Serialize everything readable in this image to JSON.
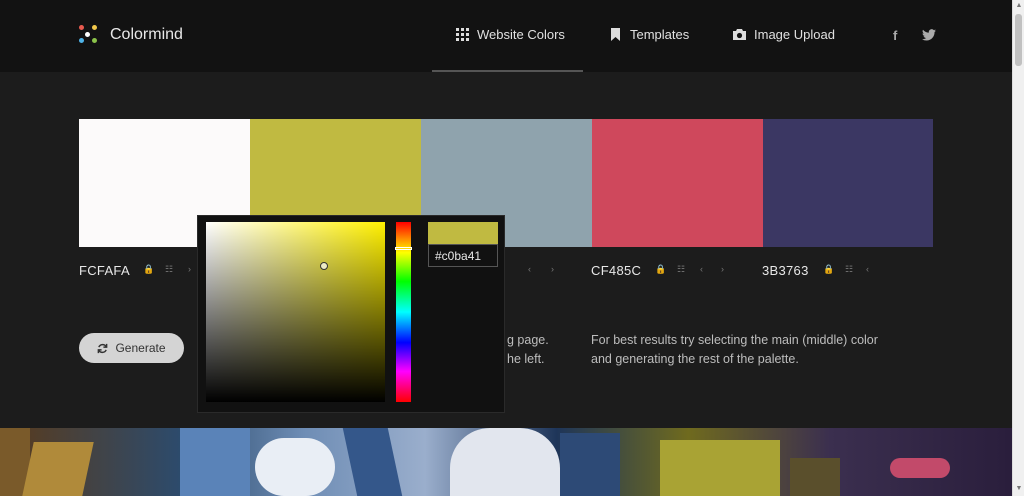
{
  "header": {
    "brand": "Colormind",
    "nav": [
      {
        "label": "Website Colors",
        "icon": "grid-icon"
      },
      {
        "label": "Templates",
        "icon": "bookmark-icon"
      },
      {
        "label": "Image Upload",
        "icon": "camera-icon"
      }
    ],
    "social": {
      "facebook": "f",
      "twitter": "twitter-icon"
    }
  },
  "palette": [
    {
      "hex": "FCFAFA",
      "color": "#fcfafa"
    },
    {
      "hex": "",
      "color": "#c0ba41"
    },
    {
      "hex": "",
      "color": "#8fa3ad"
    },
    {
      "hex": "CF485C",
      "color": "#cf485c"
    },
    {
      "hex": "3B3763",
      "color": "#3b3763"
    }
  ],
  "controls": {
    "lock": "🔒",
    "adjust": "☷",
    "left": "‹",
    "right": "›"
  },
  "generate_label": "Generate",
  "help": {
    "left_line1": "g page.",
    "left_line2": "he left.",
    "right_line1": "For best results try selecting the main (middle) color",
    "right_line2": "and generating the rest of the palette."
  },
  "picker": {
    "value": "#c0ba41",
    "preview_color": "#c0ba41"
  }
}
